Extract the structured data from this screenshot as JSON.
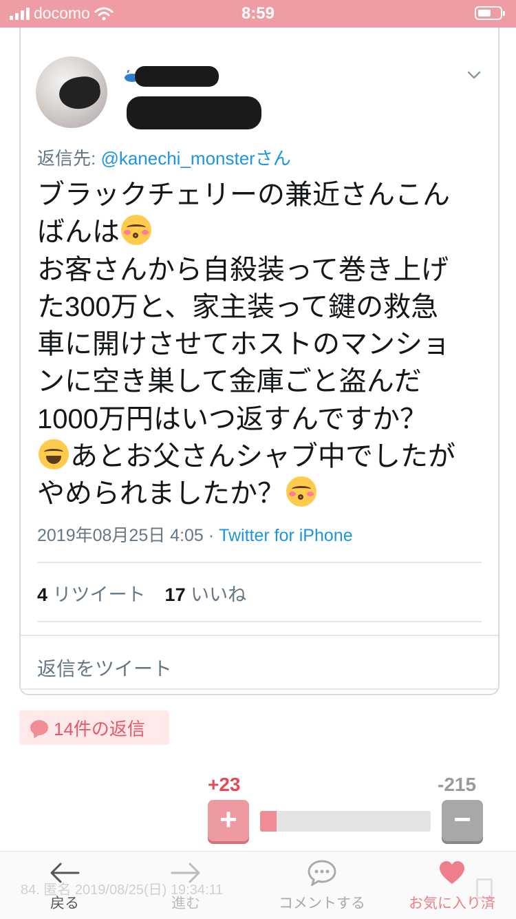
{
  "status_bar": {
    "carrier": "docomo",
    "time": "8:59"
  },
  "tweet": {
    "reply_to_label": "返信先: ",
    "reply_to_handle": "@kanechi_monsterさん",
    "text_lines": [
      "ブラックチェリーの兼近さんこん",
      "ばんは",
      "お客さんから自殺装って巻き上げ",
      "た300万と、家主装って鍵の救急",
      "車に開けさせてホストのマンショ",
      "ンに空き巣して金庫ごと盗んだ",
      "1000万円はいつ返すんですか？",
      "あとお父さんシャブ中でしたが",
      "やめられましたか？"
    ],
    "timestamp": "2019年08月25日 4:05",
    "meta_separator": " · ",
    "source": "Twitter for iPhone",
    "retweet_count": "4",
    "retweet_label": " リツイート",
    "like_count": "17",
    "like_label": " いいね",
    "reply_placeholder": "返信をツイート"
  },
  "replies": {
    "label": "14件の返信"
  },
  "votes": {
    "plus": "+23",
    "minus": "-215",
    "plus_symbol": "+",
    "minus_symbol": "−",
    "plus_fraction": 0.097
  },
  "background_post": {
    "text": "84. 匿名 2019/08/25(日) 19:34:11"
  },
  "nav": {
    "back": "戻る",
    "forward": "進む",
    "comment": "コメントする",
    "favorite": "お気に入り済"
  },
  "colors": {
    "status_bar": "#f09ca4",
    "accent": "#e14b55",
    "link": "#1b95e0",
    "favorite": "#ee7f8a"
  },
  "icons": [
    "wifi-icon",
    "battery-icon",
    "whale-icon",
    "chevron-down-icon",
    "emoji-kissing-icon",
    "emoji-laughing-icon",
    "speech-bubble-icon",
    "back-arrow-icon",
    "forward-arrow-icon",
    "comment-icon",
    "heart-icon"
  ]
}
